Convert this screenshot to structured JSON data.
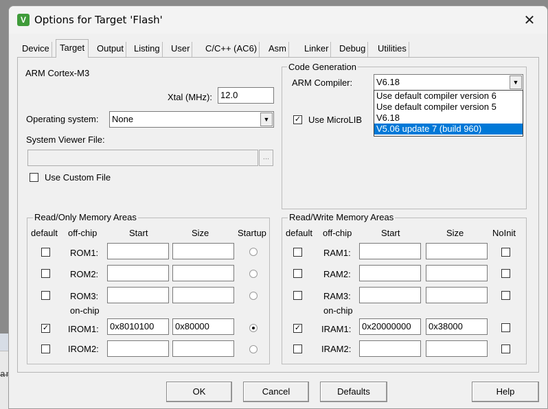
{
  "background": {
    "glyph": "ar"
  },
  "window": {
    "title": "Options for Target 'Flash'",
    "app_icon": "keil-uvision-icon",
    "close": "✕"
  },
  "tabs": [
    "Device",
    "Target",
    "Output",
    "Listing",
    "User",
    "C/C++ (AC6)",
    "Asm",
    "Linker",
    "Debug",
    "Utilities"
  ],
  "active_tab": "Target",
  "target": {
    "device": "ARM Cortex-M3",
    "xtal_label": "Xtal (MHz):",
    "xtal_value": "12.0",
    "os_label": "Operating system:",
    "os_value": "None",
    "svf_label": "System Viewer File:",
    "svf_value": "",
    "browse_label": "...",
    "custom_file_label": "Use Custom File"
  },
  "code_generation": {
    "title": "Code Generation",
    "compiler_label": "ARM Compiler:",
    "compiler_value": "V6.18",
    "options": [
      "Use default compiler version 6",
      "Use default compiler version 5",
      "V6.18",
      "V5.06 update 7 (build 960)"
    ],
    "highlighted_option": "V5.06 update 7 (build 960)",
    "microlib_label": "Use MicroLIB",
    "microlib_checked": true
  },
  "ro_memory": {
    "title": "Read/Only Memory Areas",
    "headers": {
      "default": "default",
      "offchip": "off-chip",
      "start": "Start",
      "size": "Size",
      "startup": "Startup"
    },
    "onchip_label": "on-chip",
    "rows": [
      {
        "label": "ROM1:",
        "default": false,
        "start": "",
        "size": "",
        "startup": false
      },
      {
        "label": "ROM2:",
        "default": false,
        "start": "",
        "size": "",
        "startup": false
      },
      {
        "label": "ROM3:",
        "default": false,
        "start": "",
        "size": "",
        "startup": false
      },
      {
        "label": "IROM1:",
        "default": true,
        "start": "0x8010100",
        "size": "0x80000",
        "startup": true
      },
      {
        "label": "IROM2:",
        "default": false,
        "start": "",
        "size": "",
        "startup": false
      }
    ]
  },
  "rw_memory": {
    "title": "Read/Write Memory Areas",
    "headers": {
      "default": "default",
      "offchip": "off-chip",
      "start": "Start",
      "size": "Size",
      "noinit": "NoInit"
    },
    "onchip_label": "on-chip",
    "rows": [
      {
        "label": "RAM1:",
        "default": false,
        "start": "",
        "size": "",
        "noinit": false
      },
      {
        "label": "RAM2:",
        "default": false,
        "start": "",
        "size": "",
        "noinit": false
      },
      {
        "label": "RAM3:",
        "default": false,
        "start": "",
        "size": "",
        "noinit": false
      },
      {
        "label": "IRAM1:",
        "default": true,
        "start": "0x20000000",
        "size": "0x38000",
        "noinit": false
      },
      {
        "label": "IRAM2:",
        "default": false,
        "start": "",
        "size": "",
        "noinit": false
      }
    ]
  },
  "buttons": {
    "ok": "OK",
    "cancel": "Cancel",
    "defaults": "Defaults",
    "help": "Help"
  },
  "colors": {
    "highlight": "#0078d7",
    "icon_green": "#3f9b3a"
  }
}
